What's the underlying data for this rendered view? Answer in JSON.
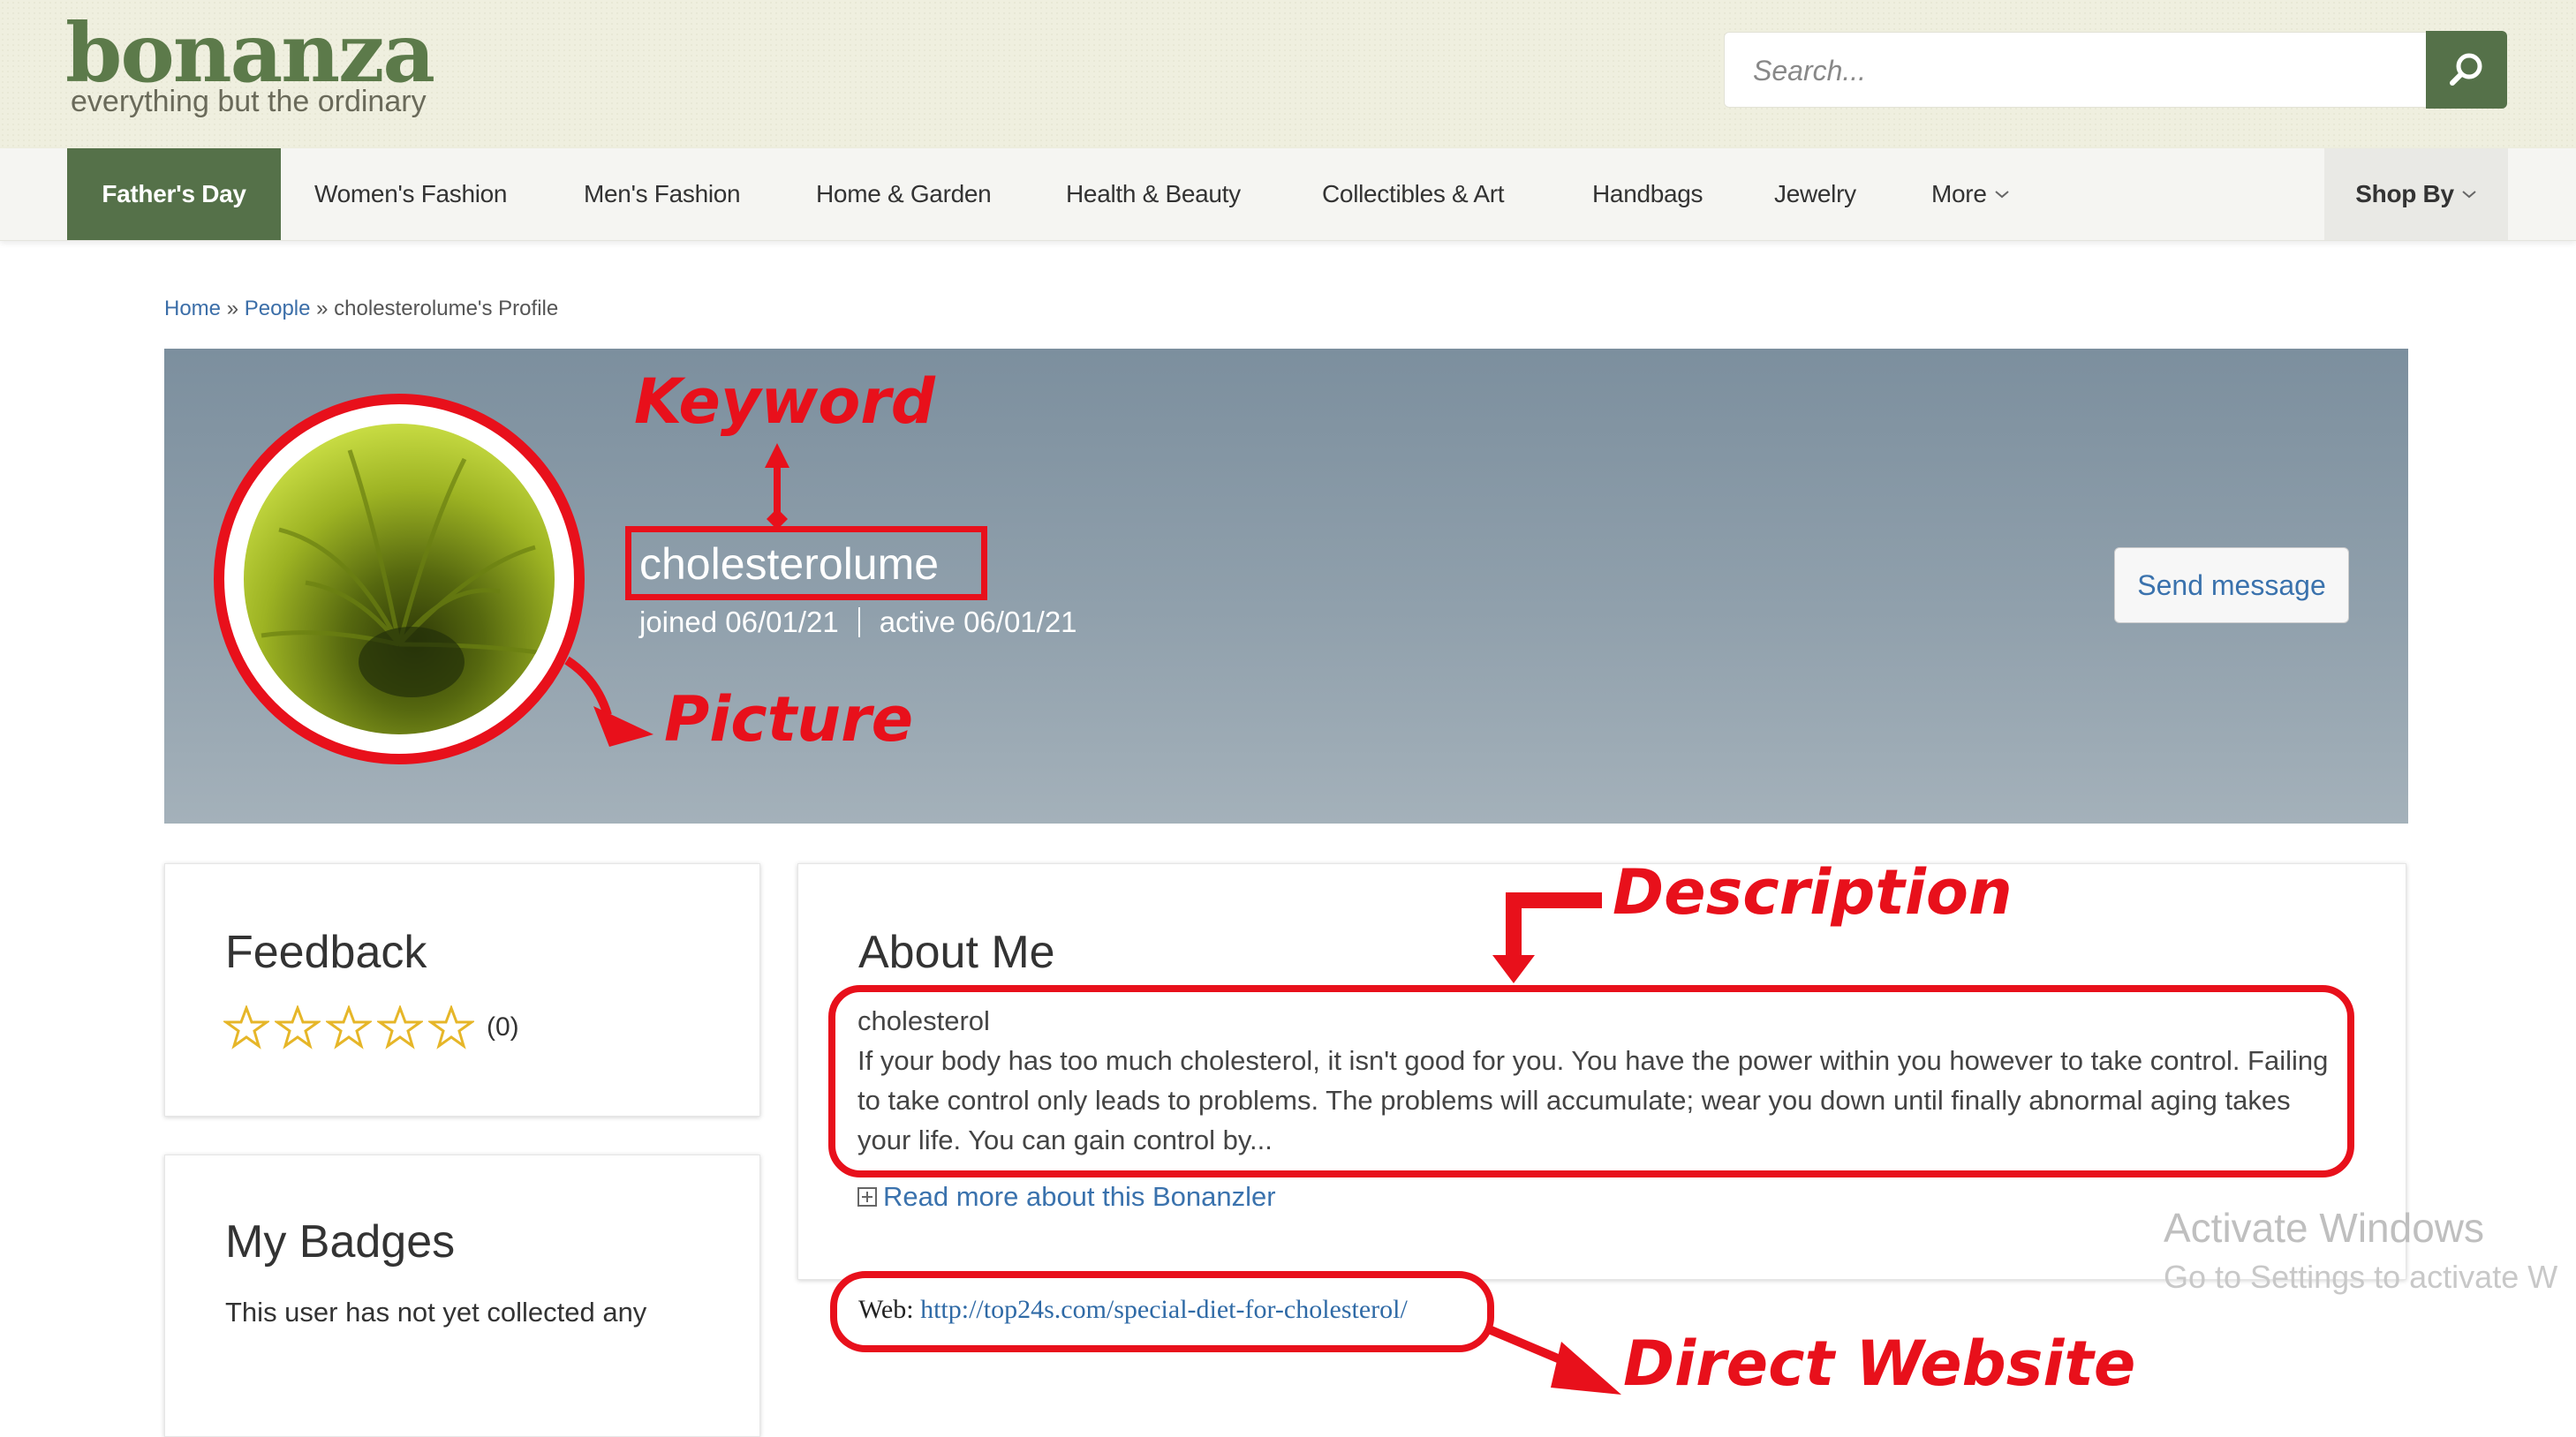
{
  "header": {
    "logo": "bonanza",
    "tagline": "everything but the ordinary",
    "search_placeholder": "Search..."
  },
  "nav": {
    "items": [
      "Father's Day",
      "Women's Fashion",
      "Men's Fashion",
      "Home & Garden",
      "Health & Beauty",
      "Collectibles & Art",
      "Handbags",
      "Jewelry",
      "More"
    ],
    "shop_by": "Shop By"
  },
  "breadcrumb": {
    "home": "Home",
    "sep": "»",
    "people": "People",
    "current": "cholesterolume's Profile"
  },
  "profile": {
    "username": "cholesterolume",
    "joined": "joined 06/01/21",
    "active": "active 06/01/21",
    "send_message": "Send message"
  },
  "feedback": {
    "title": "Feedback",
    "count": "(0)",
    "rating_stars": 0,
    "max_stars": 5
  },
  "badges": {
    "title": "My Badges",
    "text": "This user has not yet collected any"
  },
  "about": {
    "title": "About Me",
    "heading": "cholesterol",
    "body": "If your body has too much cholesterol, it isn't good for you. You have the power within you however to take control. Failing to take control only leads to problems. The problems will accumulate; wear you down until finally abnormal aging takes your life. You can gain control by...",
    "read_more": "Read more about this Bonanzler",
    "web_label": "Web:",
    "web_url": "http://top24s.com/special-diet-for-cholesterol/"
  },
  "annotations": {
    "keyword": "Keyword",
    "picture": "Picture",
    "description": "Description",
    "direct_website": "Direct Website"
  },
  "watermark": {
    "title": "Activate Windows",
    "subtitle": "Go to Settings to activate W"
  },
  "colors": {
    "brand_green": "#557149",
    "annotation_red": "#e8101b",
    "link_blue": "#3a72ad"
  }
}
